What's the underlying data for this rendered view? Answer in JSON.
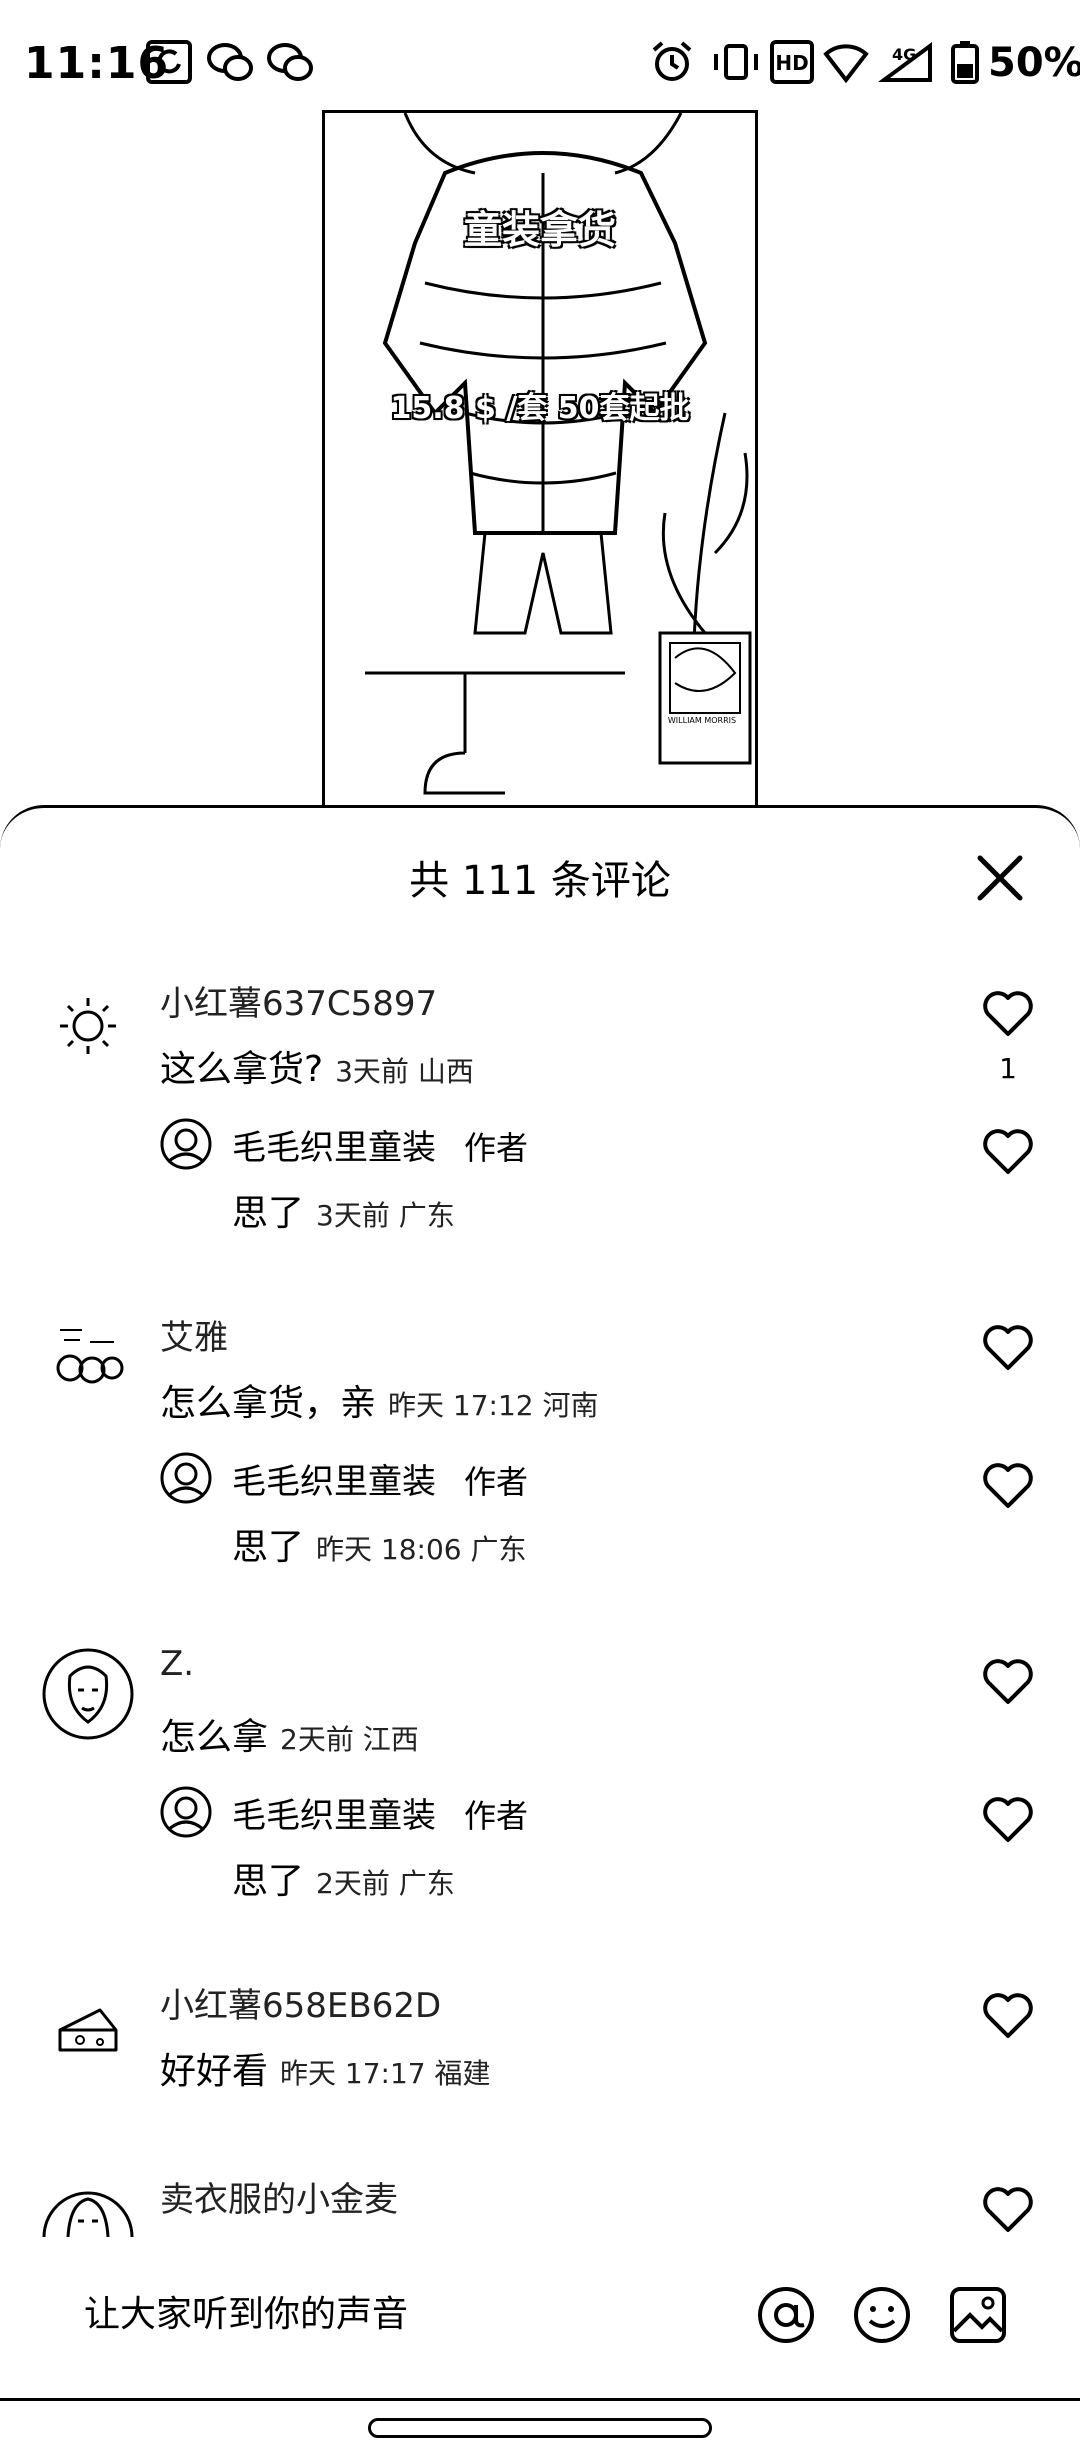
{
  "status_bar": {
    "time": "11:16",
    "battery": "50%",
    "icons": [
      "sync-icon",
      "wechat-icon",
      "wechat-icon",
      "alarm-icon",
      "vibrate-icon",
      "hd-icon",
      "wifi-icon",
      "signal-4g-icon",
      "battery-icon"
    ]
  },
  "video": {
    "caption_title": "童装拿货",
    "caption_price": "15.8 $ /套 50套起批",
    "poster_text": "WILLIAM MORRIS"
  },
  "comments_sheet": {
    "title": "共 111 条评论",
    "comments": [
      {
        "user": "小红薯637C5897",
        "text": "这么拿货?",
        "meta": "3天前 山西",
        "likes": "1",
        "reply": {
          "user": "毛毛织里童装",
          "tag": "作者",
          "text": "思了",
          "meta": "3天前 广东"
        }
      },
      {
        "user": "艾雅",
        "text": "怎么拿货，亲",
        "meta": "昨天 17:12 河南",
        "likes": "",
        "reply": {
          "user": "毛毛织里童装",
          "tag": "作者",
          "text": "思了",
          "meta": "昨天 18:06 广东"
        }
      },
      {
        "user": "Z.",
        "text": "怎么拿",
        "meta": "2天前 江西",
        "likes": "",
        "reply": {
          "user": "毛毛织里童装",
          "tag": "作者",
          "text": "思了",
          "meta": "2天前 广东"
        }
      },
      {
        "user": "小红薯658EB62D",
        "text": "好好看",
        "meta": "昨天 17:17 福建",
        "likes": ""
      },
      {
        "user": "卖衣服的小金麦",
        "text": "",
        "meta": "",
        "likes": ""
      }
    ]
  },
  "input_bar": {
    "placeholder": "让大家听到你的声音"
  }
}
